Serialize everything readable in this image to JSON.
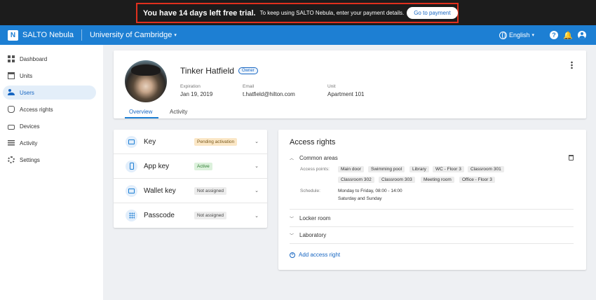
{
  "trial_banner": {
    "headline": "You have 14 days left free trial.",
    "message": "To keep using SALTO Nebula, enter your payment details.",
    "button_label": "Go to payment",
    "highlight_color": "#e0301e"
  },
  "app_bar": {
    "logo_letter": "N",
    "brand": "SALTO Nebula",
    "organization": "University of Cambridge",
    "language": "English",
    "help_glyph": "?",
    "bell_glyph": "🔔",
    "caret_glyph": "▾",
    "icons": [
      "globe-icon",
      "help-icon",
      "bell-icon",
      "account-icon"
    ],
    "color": "#1d7fd3"
  },
  "sidebar": {
    "items": [
      {
        "label": "Dashboard",
        "icon": "dashboard-icon"
      },
      {
        "label": "Units",
        "icon": "building-icon"
      },
      {
        "label": "Users",
        "icon": "users-icon",
        "active": true
      },
      {
        "label": "Access rights",
        "icon": "hand-icon"
      },
      {
        "label": "Devices",
        "icon": "device-icon"
      },
      {
        "label": "Activity",
        "icon": "list-icon"
      },
      {
        "label": "Settings",
        "icon": "gear-icon"
      }
    ]
  },
  "profile": {
    "name": "Tinker Hatfield",
    "role_badge": "Owner",
    "fields": [
      {
        "label": "Expiration",
        "value": "Jan 19, 2019"
      },
      {
        "label": "Email",
        "value": "t.hatfield@hilton.com"
      },
      {
        "label": "Unit",
        "value": "Apartment 101"
      }
    ],
    "tabs": [
      "Overview",
      "Activity"
    ],
    "active_tab": "Overview"
  },
  "keys": {
    "chevron_glyph": "⌄",
    "items": [
      {
        "label": "Key",
        "status": "Pending activation",
        "icon": "card-icon"
      },
      {
        "label": "App key",
        "status": "Active",
        "icon": "phone-icon"
      },
      {
        "label": "Wallet key",
        "status": "Not assigned",
        "icon": "wallet-icon"
      },
      {
        "label": "Passcode",
        "status": "Not assigned",
        "icon": "keypad-icon"
      }
    ]
  },
  "access_rights": {
    "title": "Access rights",
    "expanded_glyph": "︿",
    "collapsed_glyph": "﹀",
    "common_areas": {
      "label": "Common areas",
      "access_points_label": "Access points:",
      "access_points": [
        "Main door",
        "Swimming pool",
        "Library",
        "WC - Floor 3",
        "Classroom 301",
        "Classroom 302",
        "Classroom 303",
        "Meeting room",
        "Office - Floor 3"
      ],
      "schedule_label": "Schedule:",
      "schedule_line1": "Monday to Friday, 08:00 - 14:00",
      "schedule_line2": "Saturday and Sunday"
    },
    "collapsed_sections": [
      "Locker room",
      "Laboratory"
    ],
    "add_label": "Add access right",
    "add_glyph": "+"
  }
}
